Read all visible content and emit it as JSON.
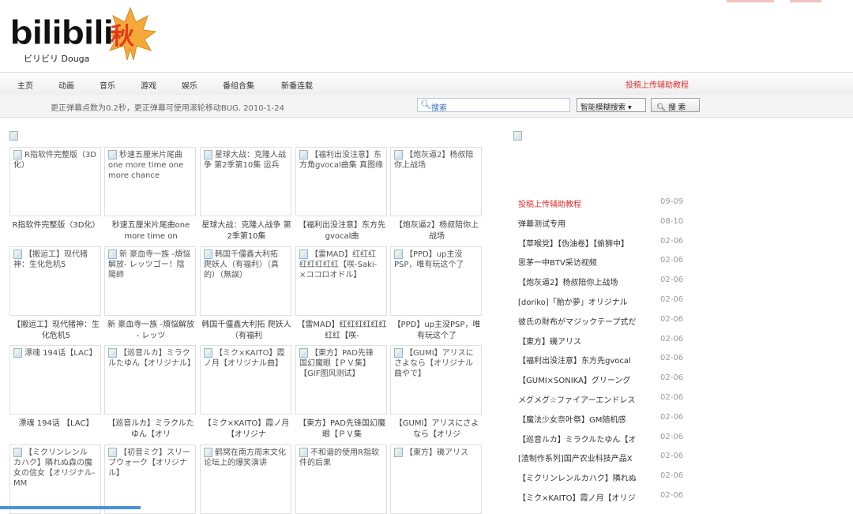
{
  "logo": {
    "text": "bilibili",
    "season_char": "秋",
    "sub": "ビリビリ Douga"
  },
  "nav": {
    "items": [
      "主页",
      "动画",
      "音乐",
      "游戏",
      "娱乐",
      "番组合集",
      "新番连载"
    ],
    "red_link": "投稿上传辅助教程"
  },
  "notice": "更正弹幕点数为0.2秒，更正弹幕可使用滚轮移动BUG. 2010-1-24",
  "search": {
    "placeholder": "搜索",
    "mode": "智能模糊搜索",
    "button": "搜 索"
  },
  "videos": [
    {
      "thumb": "R指软件完整版（3D化）",
      "caption": "R指软件完整版（3D化）"
    },
    {
      "thumb": "秒速五厘米片尾曲one more time one more chance",
      "caption": "秒速五厘米片尾曲one more time on"
    },
    {
      "thumb": "星球大战：克隆人战争 第2季第10集 运兵",
      "caption": "星球大战：克隆人战争 第2季第10集"
    },
    {
      "thumb": "【福利出没注意】东方角gvocal曲集 真图缘",
      "caption": "【福利出没注意】东方先gvocal曲"
    },
    {
      "thumb": "【炮灰逼2】杨叔陪你上战场",
      "caption": "【炮灰逼2】杨叔陪你上战场"
    },
    {
      "thumb": "【搬运工】现代猪神：生化危机5",
      "caption": "【搬运工】现代猪神：生化危机5"
    },
    {
      "thumb": "新 豪血寺一族 -煩悩解放- レッツゴー！陰陽師",
      "caption": "新 豪血寺一族 -煩悩解放 - レッツ"
    },
    {
      "thumb": "韩国千僵鑫大利拓 爬妖人（有福利）（真的）（無誤）",
      "caption": "韩国千僵鑫大利拓 爬妖人（有福利"
    },
    {
      "thumb": "【雷MAD】红红红红红红红红【咲-Saki-×ココロオドル】",
      "caption": "【雷MAD】红红红红红红红红【咲-"
    },
    {
      "thumb": "【PPD】up主没PSP，唯有玩这个了",
      "caption": "【PPD】up主没PSP，唯有玩这个了"
    },
    {
      "thumb": "漂魂 194话【LAC】",
      "caption": "漂魂 194话 【LAC】"
    },
    {
      "thumb": "【巡音ルカ】ミラクルたゆん【オリジナル】",
      "caption": "【巡音ルカ】ミラクルたゆん【オリ"
    },
    {
      "thumb": "【ミク×KAITO】霞ノ月【オリジナル曲】",
      "caption": "【ミク×KAITO】霞ノ月【オリジナ"
    },
    {
      "thumb": "【東方】PAD先锋 国幻魔眼【ＰＶ集】【GIF图风测试】",
      "caption": "【東方】PAD先锋国幻魔眼【ＰＶ集"
    },
    {
      "thumb": "【GUMI】アリスにさよなら【オリジナル曲やで】",
      "caption": "【GUMI】アリスにさよなら【オリジ"
    },
    {
      "thumb": "【ミクリンレンル カハク】隣れぬ森の魔女の信女【オリジナル-MM",
      "caption": ""
    },
    {
      "thumb": "【初音ミク】スリープウォーク【オリジナル】",
      "caption": ""
    },
    {
      "thumb": "鹤窝在南方周末文化论坛上的爆笑演讲",
      "caption": ""
    },
    {
      "thumb": "不和谐的使用R指软件的后果",
      "caption": ""
    },
    {
      "thumb": "【東方】磯アリス",
      "caption": ""
    }
  ],
  "right_list": [
    {
      "title": "投稿上传辅助教程",
      "date": "09-09",
      "red": true
    },
    {
      "title": "弹幕测试专用",
      "date": "08-10"
    },
    {
      "title": "【草喉党】【伪油卷】【偷狮中】",
      "date": "02-06"
    },
    {
      "title": "思茅一中BTV采访视频",
      "date": "02-06"
    },
    {
      "title": "【炮灰逼2】杨叔陪你上战场",
      "date": "02-06"
    },
    {
      "title": "[doriko]「胎か夢」オリジナル",
      "date": "02-06"
    },
    {
      "title": "彼氏の財布がマジックテープ式だ",
      "date": "02-06"
    },
    {
      "title": "【東方】磯アリス",
      "date": "02-06"
    },
    {
      "title": "【福利出没注意】东方先gvocal",
      "date": "02-06"
    },
    {
      "title": "【GUMI×SONIKA】グリーング",
      "date": "02-06"
    },
    {
      "title": "メグメグ☆ファイアーエンドレス",
      "date": "02-06"
    },
    {
      "title": "【魔法少女奈叶祭】GM随机感",
      "date": "02-06"
    },
    {
      "title": "【巡音ルカ】ミラクルたゆん【オ",
      "date": "02-06"
    },
    {
      "title": "[渣制作系列]国产农业科技产品X",
      "date": "02-06"
    },
    {
      "title": "【ミクリンレンルカハク】隣れぬ",
      "date": "02-06"
    },
    {
      "title": "【ミク×KAITO】霞ノ月【オリジ",
      "date": "02-06"
    }
  ]
}
